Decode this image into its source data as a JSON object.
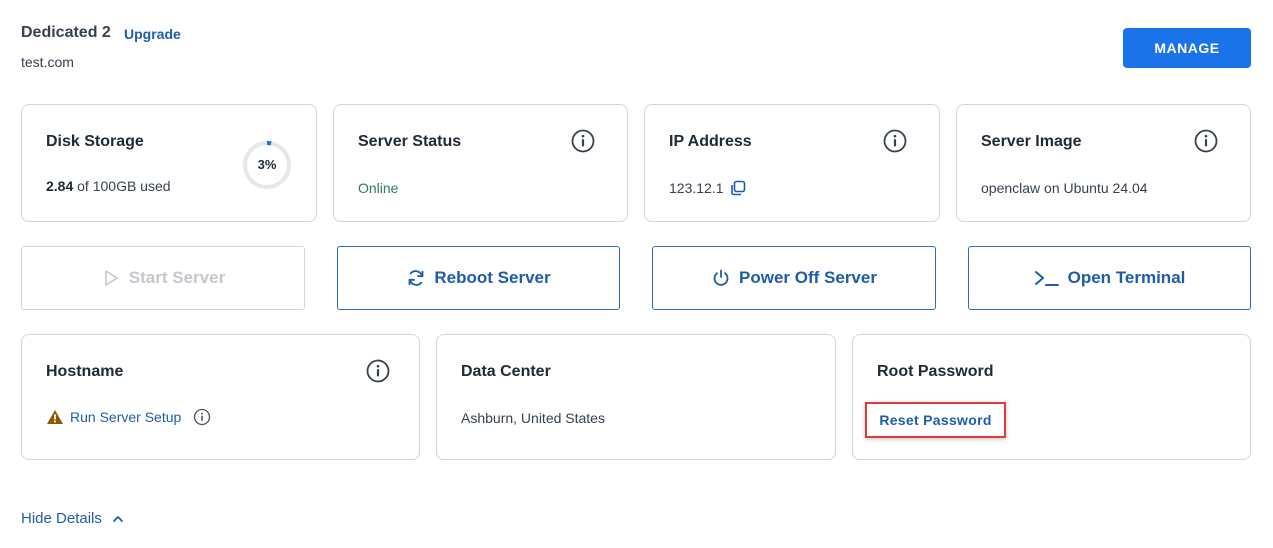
{
  "header": {
    "plan_name": "Dedicated 2",
    "upgrade_label": "Upgrade",
    "domain": "test.com",
    "manage_label": "MANAGE"
  },
  "cards": {
    "disk": {
      "title": "Disk Storage",
      "used": "2.84",
      "suffix": "of 100GB used",
      "percent_label": "3%",
      "percent": 3
    },
    "status": {
      "title": "Server Status",
      "value": "Online"
    },
    "ip": {
      "title": "IP Address",
      "value": "123.12.1"
    },
    "image": {
      "title": "Server Image",
      "value": "openclaw on Ubuntu 24.04"
    },
    "hostname": {
      "title": "Hostname",
      "action": "Run Server Setup"
    },
    "datacenter": {
      "title": "Data Center",
      "value": "Ashburn, United States"
    },
    "root": {
      "title": "Root Password",
      "action": "Reset Password"
    }
  },
  "actions": {
    "start": "Start Server",
    "reboot": "Reboot Server",
    "power_off": "Power Off Server",
    "terminal": "Open Terminal"
  },
  "footer": {
    "hide_details": "Hide Details"
  },
  "colors": {
    "accent": "#1a73e8",
    "link": "#1f5da8",
    "online": "#2e7d5b",
    "warning": "#8a5a00",
    "highlight": "#e53935"
  }
}
